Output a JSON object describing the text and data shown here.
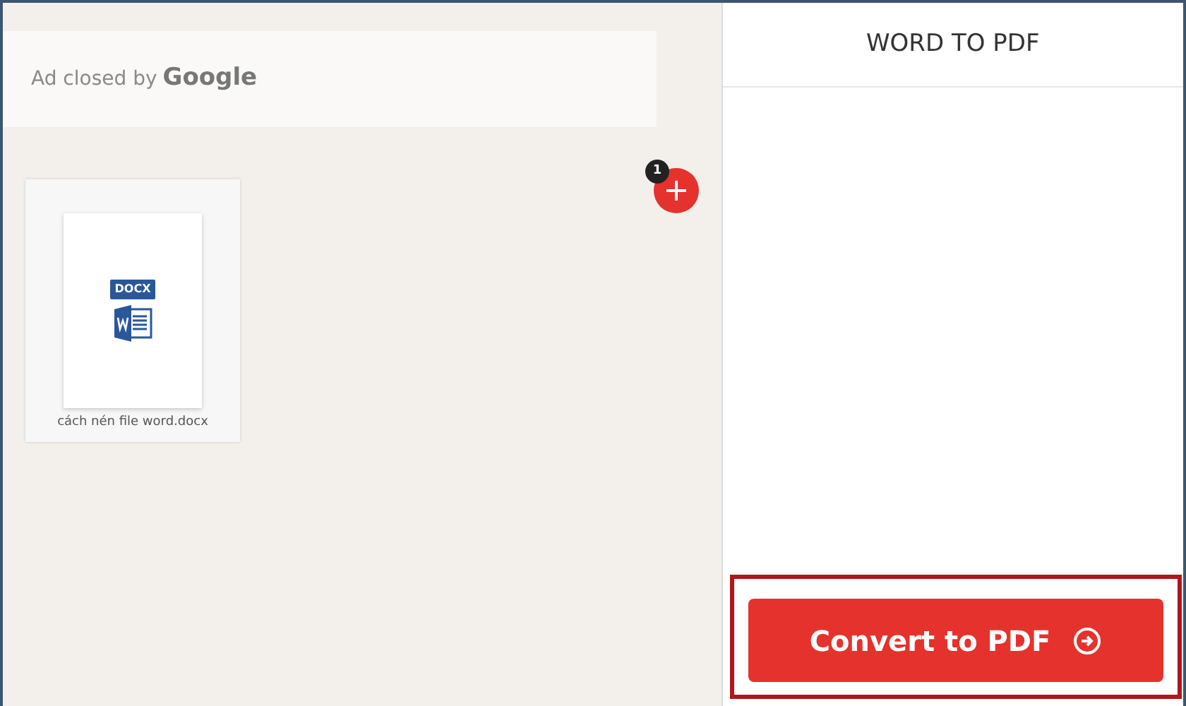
{
  "ad": {
    "text": "Ad closed by",
    "brand": "Google"
  },
  "files": [
    {
      "name": "cách nén file word.docx",
      "type_label": "DOCX"
    }
  ],
  "add_button": {
    "badge": "1"
  },
  "sidebar": {
    "title": "WORD TO PDF",
    "action": "Convert to PDF",
    "highlighted": true
  }
}
